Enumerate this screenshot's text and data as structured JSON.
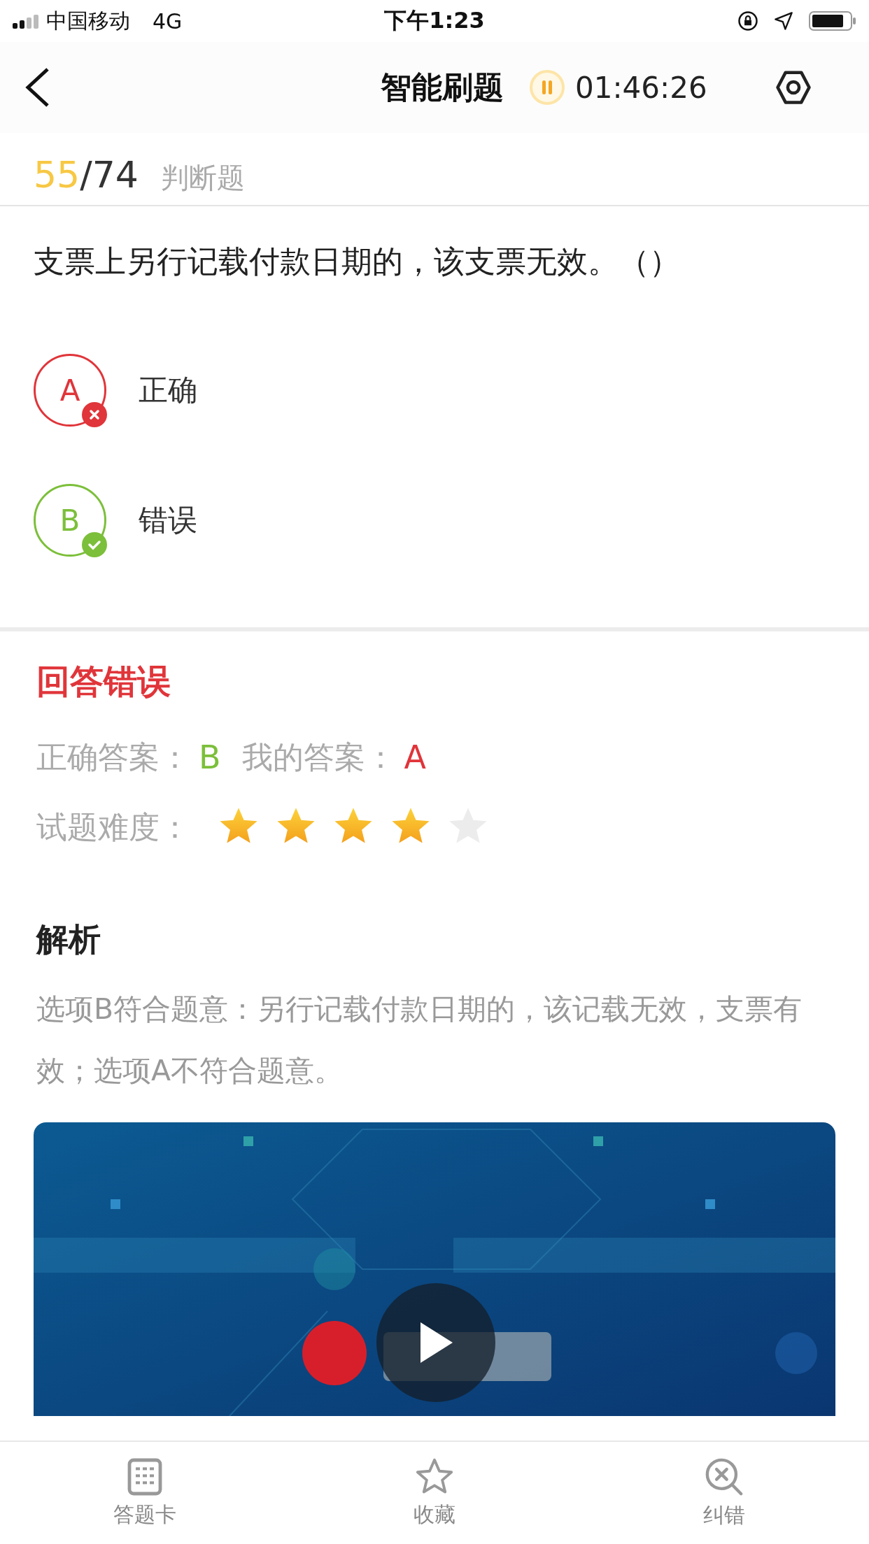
{
  "status_bar": {
    "carrier": "中国移动",
    "network": "4G",
    "time": "下午1:23"
  },
  "header": {
    "title": "智能刷题",
    "timer": "01:46:26"
  },
  "progress": {
    "current": "55",
    "separator": "/",
    "total": "74",
    "type": "判断题"
  },
  "question": {
    "text": "支票上另行记载付款日期的，该支票无效。（）"
  },
  "options": [
    {
      "letter": "A",
      "text": "正确",
      "kind": "wrong"
    },
    {
      "letter": "B",
      "text": "错误",
      "kind": "correct"
    }
  ],
  "result": {
    "title": "回答错误",
    "correct_label": "正确答案：",
    "correct_value": "B",
    "my_label": "我的答案：",
    "my_value": "A",
    "difficulty_label": "试题难度：",
    "stars": 4
  },
  "analysis": {
    "title": "解析",
    "text": "选项B符合题意：另行记载付款日期的，该记载无效，支票有效；选项A不符合题意。"
  },
  "bottom_tabs": [
    {
      "label": "答题卡"
    },
    {
      "label": "收藏"
    },
    {
      "label": "纠错"
    }
  ]
}
